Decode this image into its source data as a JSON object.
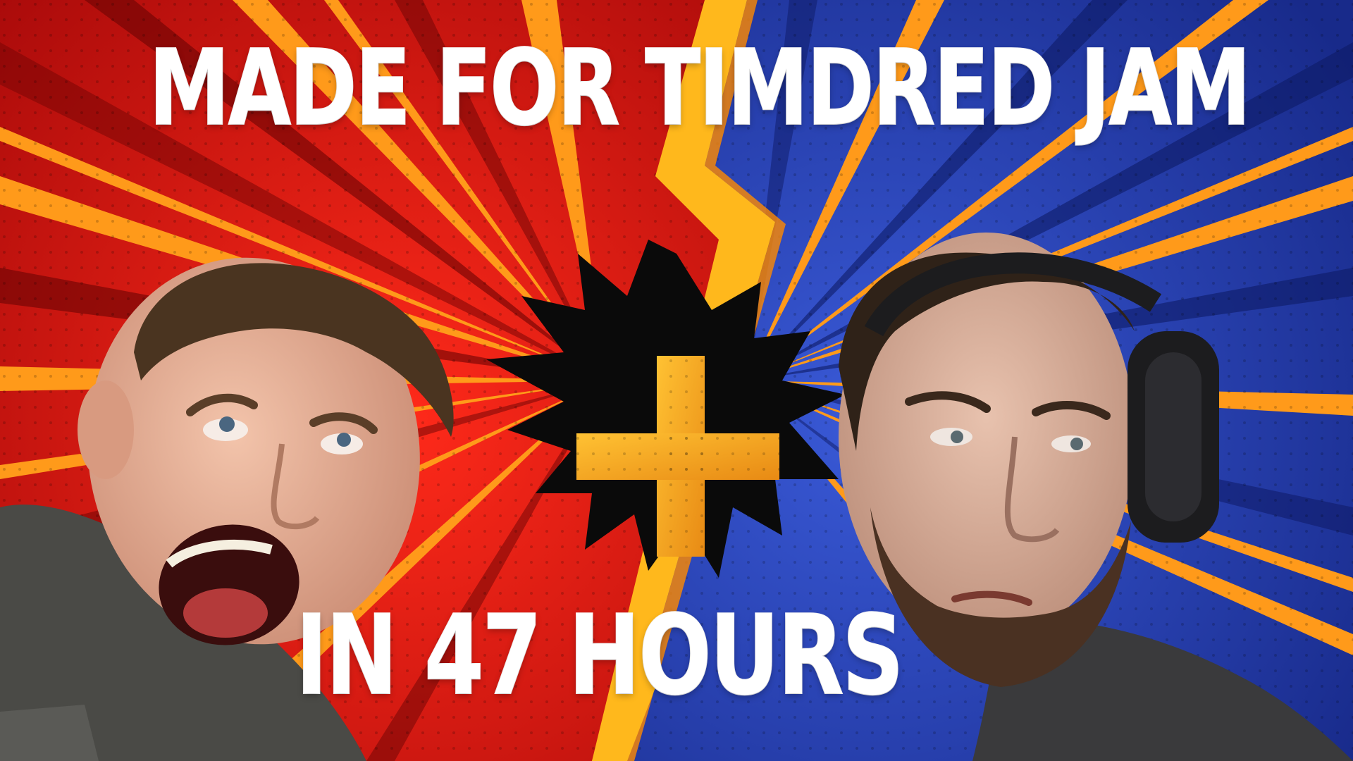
{
  "thumbnail": {
    "top_text": "MADE FOR TIMDRED JAM",
    "bottom_text": "IN 47 HOURS"
  },
  "colors": {
    "left_bg": "#e41414",
    "right_bg": "#2b45b8",
    "accent_orange": "#ff9a1a",
    "bolt_yellow": "#ffb81c",
    "burst_black": "#0a0a0a",
    "plus_gold": "#f3a91d",
    "skin": "#e9b49a",
    "hair_brown": "#4a3420",
    "shirt_gray": "#4a4a46",
    "headphones": "#1c1c1e"
  },
  "graphics": {
    "center_symbol": "plus-icon",
    "background_style": "comic-versus-split",
    "left_subject": "shouting-man-photo",
    "right_subject": "skeptical-man-with-headphones-photo"
  }
}
